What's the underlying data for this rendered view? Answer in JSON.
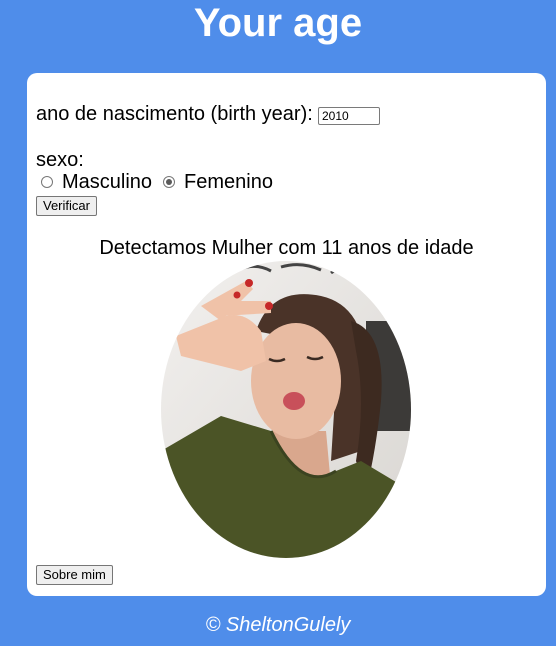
{
  "header": {
    "title": "Your age"
  },
  "form": {
    "birth_year_label": "ano de nascimento (birth year):",
    "birth_year_value": "2010",
    "sex_label": "sexo:",
    "options": [
      {
        "label": "Masculino",
        "checked": false
      },
      {
        "label": "Femenino",
        "checked": true
      }
    ],
    "verify_button": "Verificar"
  },
  "result": {
    "text": "Detectamos Mulher com 11 anos de idade",
    "photo_icon": "person-photo-icon"
  },
  "about_button": "Sobre mim",
  "footer": {
    "text": "© SheltonGulely"
  },
  "colors": {
    "background": "#4f8dea",
    "card": "#ffffff",
    "title": "#ffffff"
  }
}
